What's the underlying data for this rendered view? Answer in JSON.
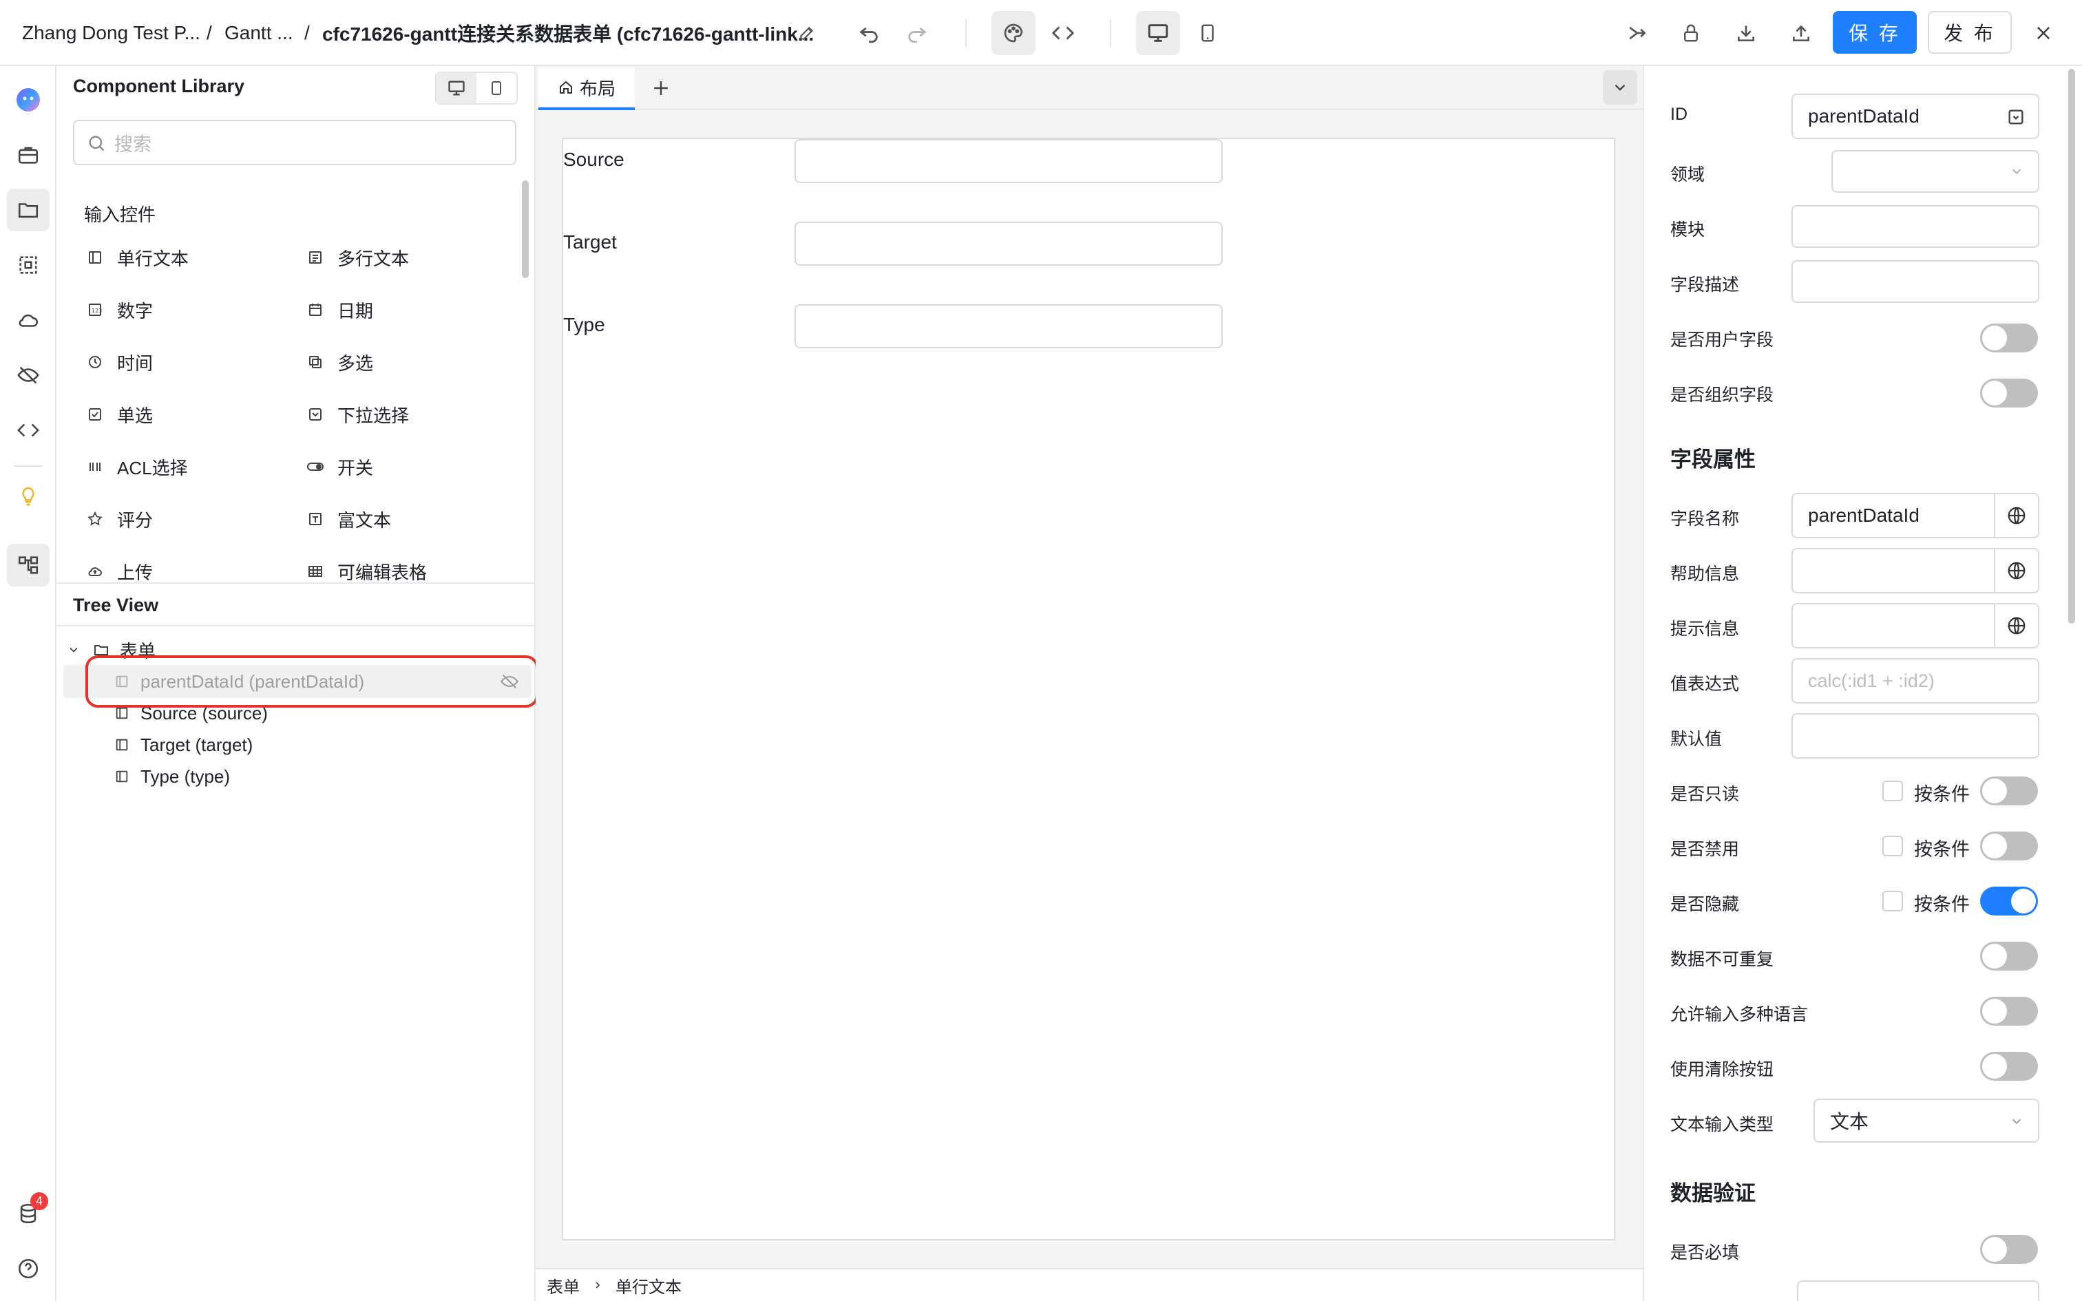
{
  "header": {
    "breadcrumb_project": "Zhang Dong Test P...",
    "breadcrumb_sep1": "/",
    "breadcrumb_app": "Gantt ...",
    "breadcrumb_sep2": "/",
    "breadcrumb_form": "cfc71626-gantt连接关系数据表单 (cfc71626-gantt-link...",
    "save_label": "保 存",
    "publish_label": "发 布"
  },
  "rail": {
    "notification_count": "4"
  },
  "library": {
    "title": "Component Library",
    "search_placeholder": "搜索",
    "section_input": "输入控件",
    "components": [
      {
        "label": "单行文本",
        "icon": "single-line-text-icon"
      },
      {
        "label": "多行文本",
        "icon": "multi-line-text-icon"
      },
      {
        "label": "数字",
        "icon": "number-icon"
      },
      {
        "label": "日期",
        "icon": "calendar-icon"
      },
      {
        "label": "时间",
        "icon": "clock-icon"
      },
      {
        "label": "多选",
        "icon": "multi-select-icon"
      },
      {
        "label": "单选",
        "icon": "checkbox-icon"
      },
      {
        "label": "下拉选择",
        "icon": "dropdown-icon"
      },
      {
        "label": "ACL选择",
        "icon": "acl-icon"
      },
      {
        "label": "开关",
        "icon": "toggle-icon"
      },
      {
        "label": "评分",
        "icon": "star-icon"
      },
      {
        "label": "富文本",
        "icon": "rich-text-icon"
      },
      {
        "label": "上传",
        "icon": "upload-icon"
      },
      {
        "label": "可编辑表格",
        "icon": "table-icon"
      }
    ]
  },
  "tree": {
    "title": "Tree View",
    "root": "表单",
    "nodes": [
      {
        "label": "parentDataId (parentDataId)",
        "hidden": true
      },
      {
        "label": "Source (source)",
        "hidden": false
      },
      {
        "label": "Target (target)",
        "hidden": false
      },
      {
        "label": "Type (type)",
        "hidden": false
      }
    ]
  },
  "canvas": {
    "tab_label": "布局",
    "fields": [
      {
        "label": "Source"
      },
      {
        "label": "Target"
      },
      {
        "label": "Type"
      }
    ],
    "status_path": [
      "表单",
      "单行文本"
    ]
  },
  "props": {
    "id_label": "ID",
    "id_value": "parentDataId",
    "domain_label": "领域",
    "module_label": "模块",
    "field_desc_label": "字段描述",
    "is_user_field_label": "是否用户字段",
    "is_org_field_label": "是否组织字段",
    "section_field_props": "字段属性",
    "field_name_label": "字段名称",
    "field_name_value": "parentDataId",
    "help_label": "帮助信息",
    "hint_label": "提示信息",
    "expr_label": "值表达式",
    "expr_placeholder": "calc(:id1 + :id2)",
    "default_label": "默认值",
    "readonly_label": "是否只读",
    "disabled_label": "是否禁用",
    "hidden_label": "是否隐藏",
    "condition_label": "按条件",
    "unique_label": "数据不可重复",
    "multilang_label": "允许输入多种语言",
    "clear_btn_label": "使用清除按钮",
    "input_type_label": "文本输入类型",
    "input_type_value": "文本",
    "section_validation": "数据验证",
    "required_label": "是否必填",
    "toggles": {
      "is_user_field": false,
      "is_org_field": false,
      "readonly": false,
      "disabled": false,
      "hidden": true,
      "unique": false,
      "multilang": false,
      "clear_btn": false,
      "required": false
    }
  },
  "colors": {
    "accent": "#1e80ff",
    "highlight": "#e5332a"
  }
}
